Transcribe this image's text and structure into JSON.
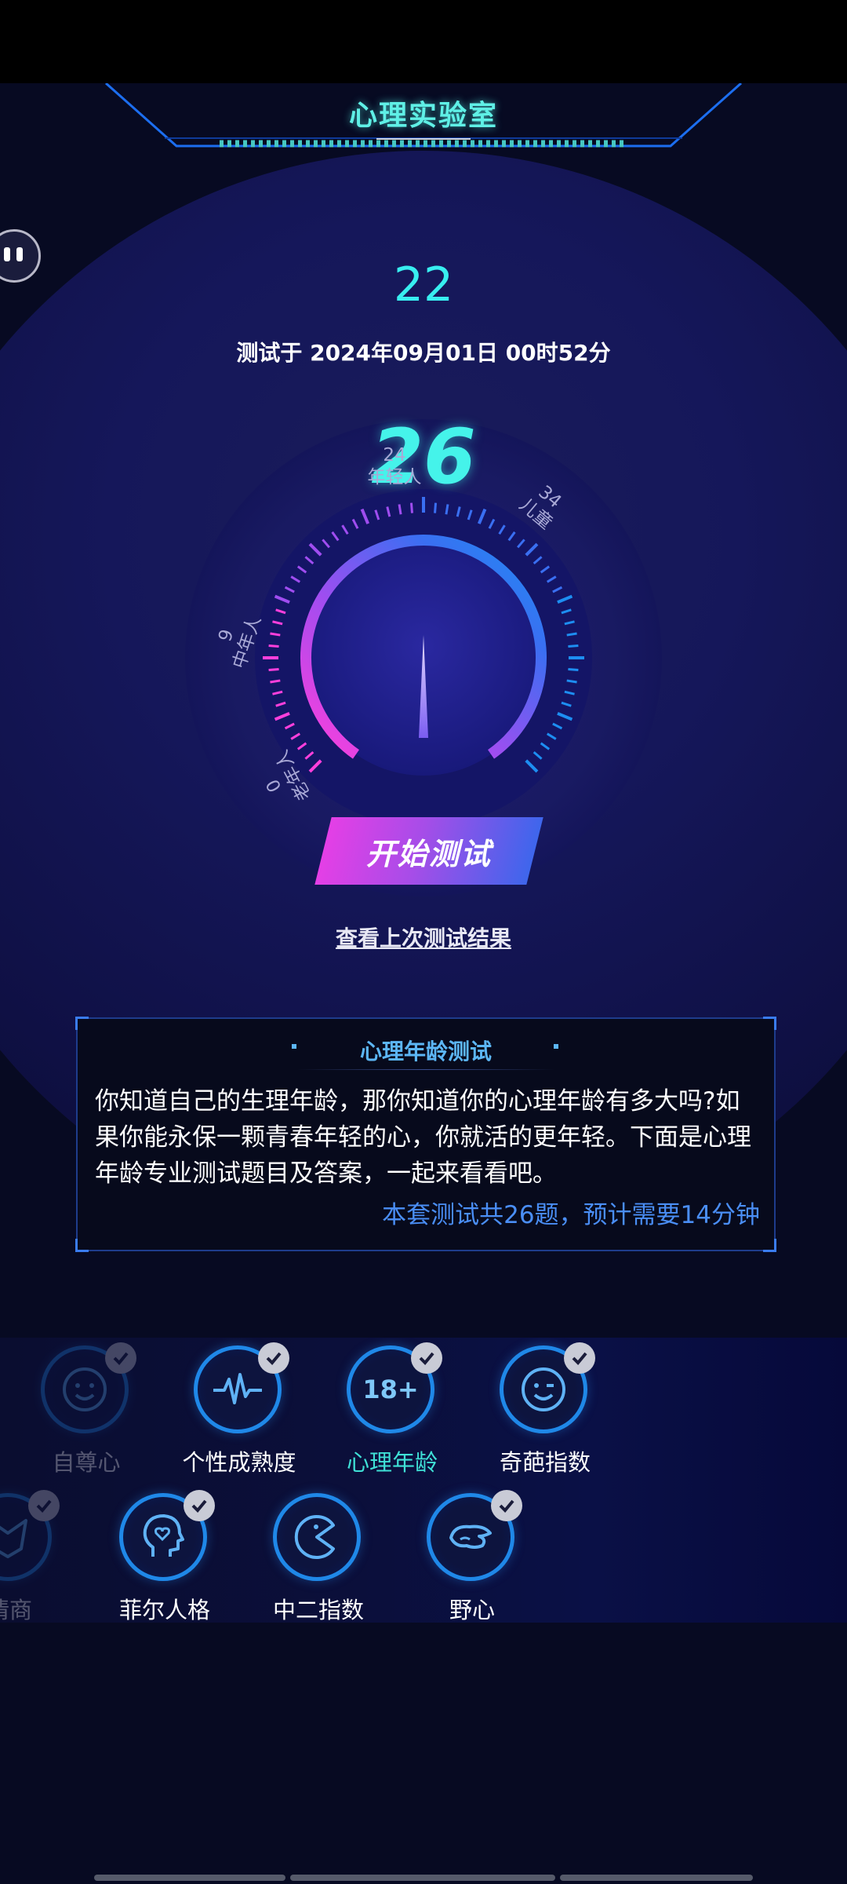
{
  "header": {
    "title": "心理实验室"
  },
  "result": {
    "score": "22",
    "test_time": "测试于 2024年09月01日 00时52分"
  },
  "gauge": {
    "value": "26",
    "labels": {
      "youth_age": "24",
      "youth": "年轻人",
      "child_age": "34",
      "child": "儿童",
      "middle_age": "9",
      "middle": "中年人",
      "old_age": "0",
      "old": "老年人"
    },
    "arc_colors": [
      "#ff3fdc",
      "#a04df0",
      "#3a6ff2",
      "#1d8ef2"
    ]
  },
  "actions": {
    "start_label": "开始测试",
    "last_result_label": "查看上次测试结果"
  },
  "info": {
    "title": "心理年龄测试",
    "description": "你知道自己的生理年龄，那你知道你的心理年龄有多大吗?如果你能永保一颗青春年轻的心，你就活的更年轻。下面是心理年龄专业测试题目及答案，一起来看看吧。",
    "summary": "本套测试共26题，预计需要14分钟"
  },
  "tests": [
    {
      "label": "自尊心",
      "icon": "smiley-face-icon"
    },
    {
      "label": "个性成熟度",
      "icon": "heartbeat-icon"
    },
    {
      "label": "心理年龄",
      "icon": "18-plus-icon",
      "badge": "18+"
    },
    {
      "label": "奇葩指数",
      "icon": "wink-face-icon"
    },
    {
      "label": "情商",
      "icon": "fox-face-icon"
    },
    {
      "label": "菲尔人格",
      "icon": "head-heart-icon"
    },
    {
      "label": "中二指数",
      "icon": "pacman-icon"
    },
    {
      "label": "野心",
      "icon": "wing-icon"
    }
  ],
  "colors": {
    "accent_cyan": "#38eef0",
    "accent_blue": "#4a8ef5",
    "ring_blue": "#1f88e8"
  }
}
